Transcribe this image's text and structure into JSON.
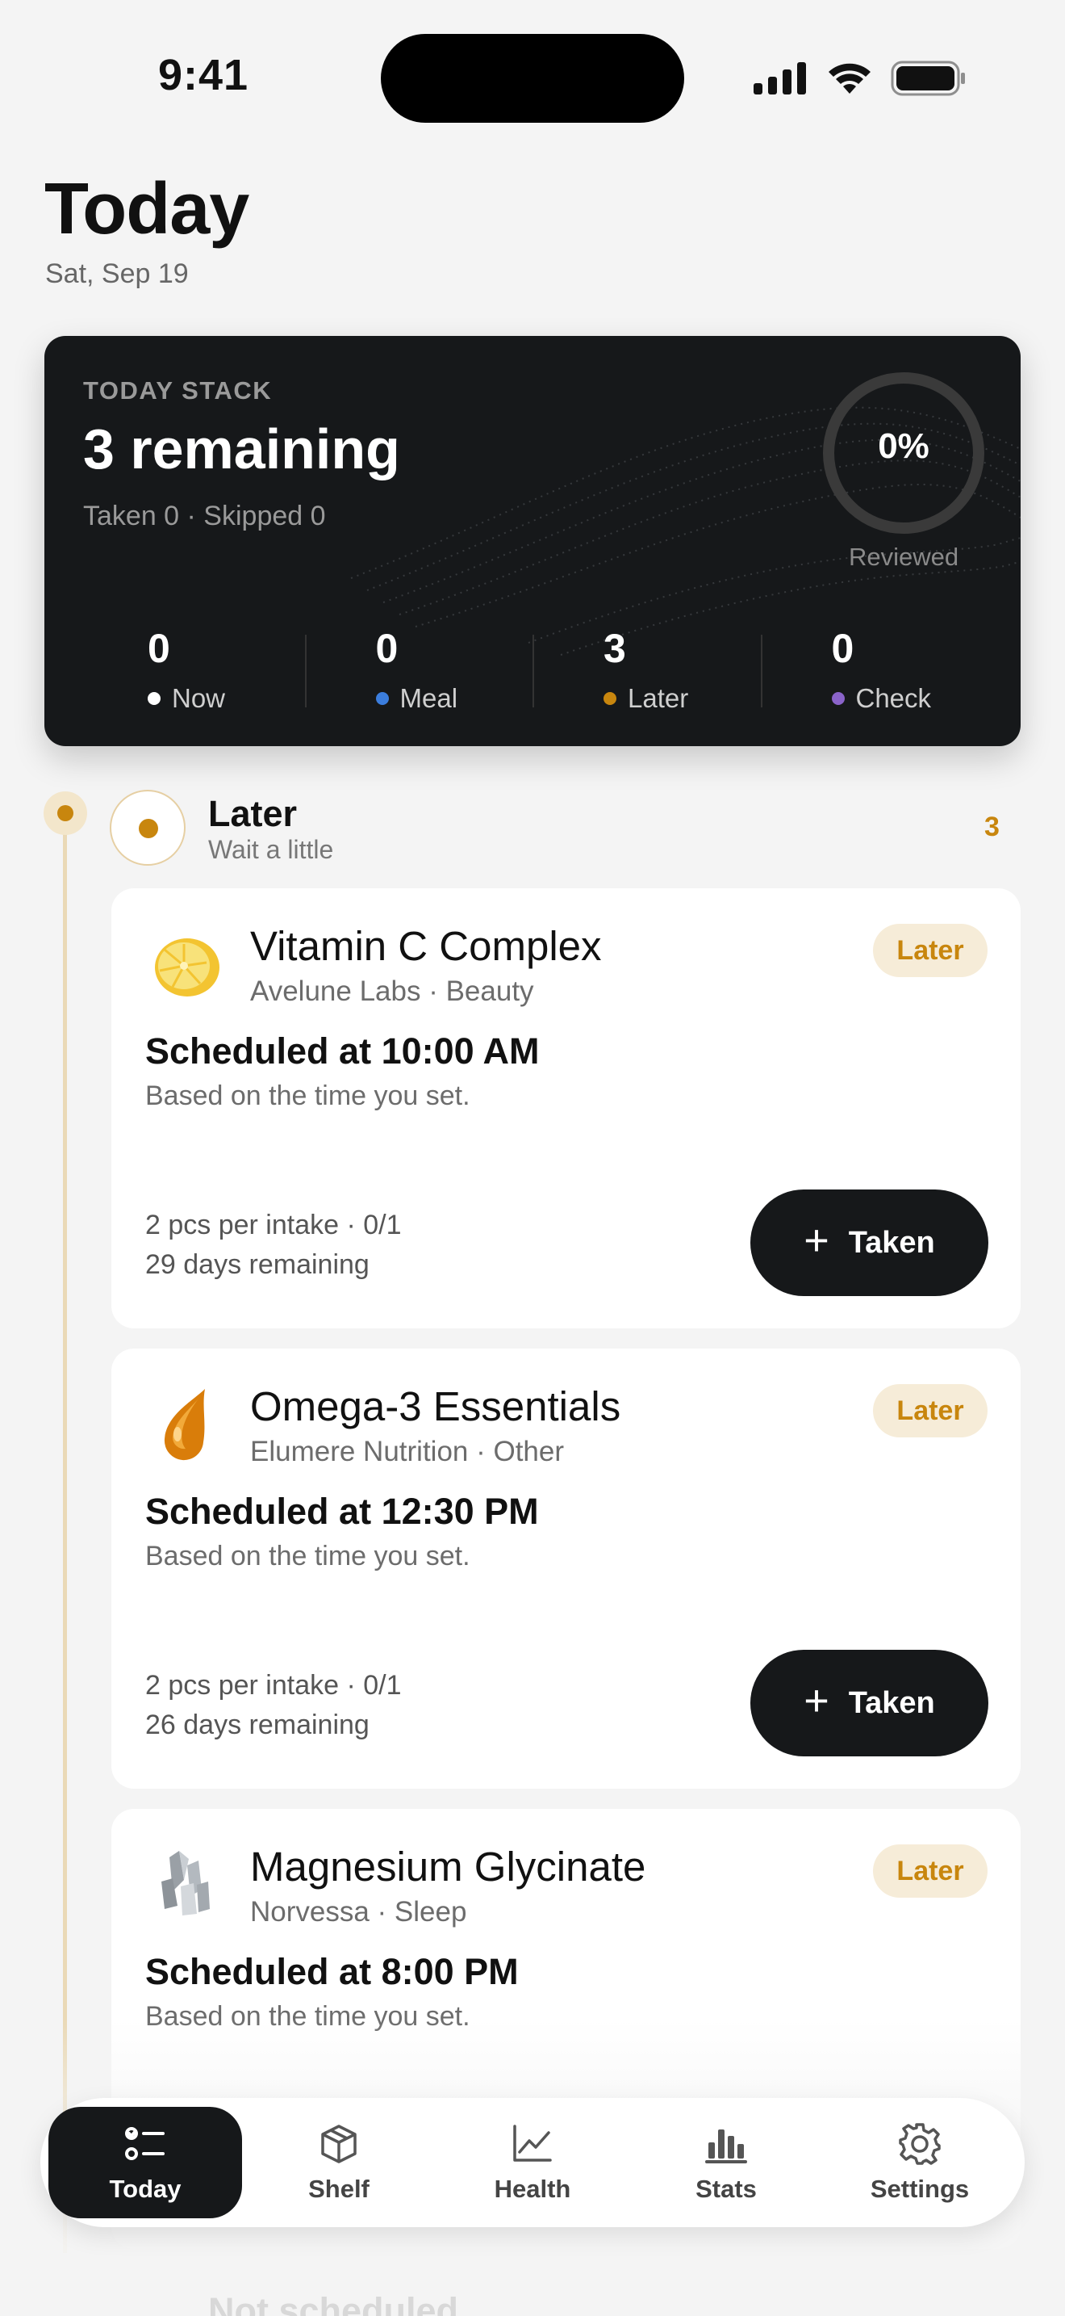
{
  "status_bar": {
    "time": "9:41"
  },
  "header": {
    "title": "Today",
    "date": "Sat, Sep 19"
  },
  "hero": {
    "label": "TODAY STACK",
    "remaining": "3 remaining",
    "summary": "Taken 0 · Skipped 0",
    "progress_percent": 0,
    "progress_text": "0%",
    "progress_label": "Reviewed",
    "stats": [
      {
        "value": "0",
        "label": "Now",
        "color": "#ffffff"
      },
      {
        "value": "0",
        "label": "Meal",
        "color": "#3b7ddd"
      },
      {
        "value": "3",
        "label": "Later",
        "color": "#c8860e"
      },
      {
        "value": "0",
        "label": "Check",
        "color": "#8a63c9"
      }
    ]
  },
  "section": {
    "title": "Later",
    "subtitle": "Wait a little",
    "count": "3",
    "accent": "#c8860e"
  },
  "items": [
    {
      "icon": "lemon-icon",
      "name": "Vitamin C Complex",
      "meta": "Avelune Labs · Beauty",
      "badge": "Later",
      "schedule": "Scheduled at 10:00 AM",
      "basis": "Based on the time you set.",
      "dose": "2 pcs per intake · 0/1",
      "remaining": "29 days remaining",
      "button": "Taken"
    },
    {
      "icon": "oil-drop-icon",
      "name": "Omega-3 Essentials",
      "meta": "Elumere Nutrition · Other",
      "badge": "Later",
      "schedule": "Scheduled at 12:30 PM",
      "basis": "Based on the time you set.",
      "dose": "2 pcs per intake · 0/1",
      "remaining": "26 days remaining",
      "button": "Taken"
    },
    {
      "icon": "crystal-icon",
      "name": "Magnesium Glycinate",
      "meta": "Norvessa · Sleep",
      "badge": "Later",
      "schedule": "Scheduled at 8:00 PM",
      "basis": "Based on the time you set."
    }
  ],
  "next_section": {
    "title": "Not scheduled"
  },
  "tabbar": {
    "tabs": [
      {
        "label": "Today",
        "icon": "checklist-icon",
        "active": true
      },
      {
        "label": "Shelf",
        "icon": "box-icon",
        "active": false
      },
      {
        "label": "Health",
        "icon": "chart-line-icon",
        "active": false
      },
      {
        "label": "Stats",
        "icon": "bar-chart-icon",
        "active": false
      },
      {
        "label": "Settings",
        "icon": "gear-icon",
        "active": false
      }
    ]
  }
}
